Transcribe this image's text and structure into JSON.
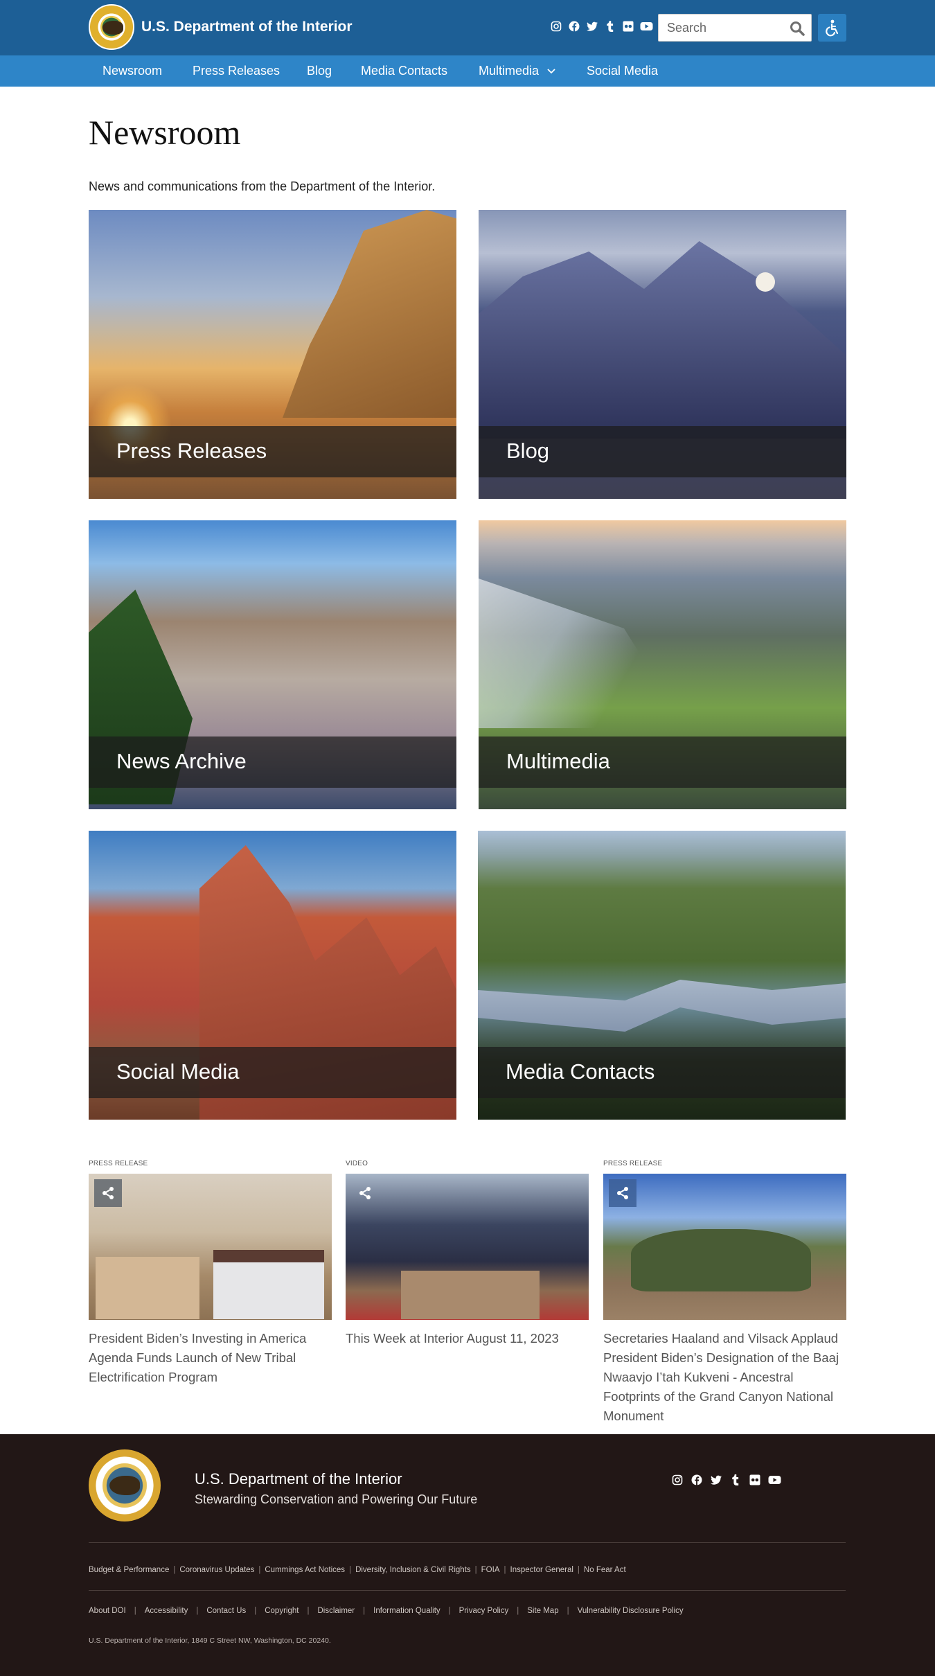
{
  "header": {
    "site_title": "U.S. Department of the Interior",
    "search_placeholder": "Search",
    "social_icons": [
      "instagram-icon",
      "facebook-icon",
      "twitter-icon",
      "tumblr-icon",
      "flickr-icon",
      "youtube-icon"
    ]
  },
  "nav": {
    "items": [
      {
        "label": "Newsroom"
      },
      {
        "label": "Press Releases"
      },
      {
        "label": "Blog"
      },
      {
        "label": "Media Contacts"
      },
      {
        "label": "Multimedia"
      },
      {
        "label": "Social Media"
      }
    ]
  },
  "main": {
    "title": "Newsroom",
    "intro": "News and communications from the Department of the Interior.",
    "tiles": [
      {
        "label": "Press Releases"
      },
      {
        "label": "Blog"
      },
      {
        "label": "News Archive"
      },
      {
        "label": "Multimedia"
      },
      {
        "label": "Social Media"
      },
      {
        "label": "Media Contacts"
      }
    ]
  },
  "featured": [
    {
      "kicker": "PRESS RELEASE",
      "title": "President Biden’s Investing in America Agenda Funds Launch of New Tribal Electrification Program"
    },
    {
      "kicker": "VIDEO",
      "title": "This Week at Interior August 11, 2023"
    },
    {
      "kicker": "PRESS RELEASE",
      "title": "Secretaries Haaland and Vilsack Applaud President Biden’s Designation of the Baaj Nwaavjo I’tah Kukveni - Ancestral Footprints of the Grand Canyon National Monument"
    }
  ],
  "footer": {
    "org_name": "U.S. Department of the Interior",
    "tagline": "Stewarding Conservation and Powering Our Future",
    "links_row1": [
      "Budget & Performance",
      "Coronavirus Updates",
      "Cummings Act Notices",
      "Diversity, Inclusion & Civil Rights",
      "FOIA",
      "Inspector General",
      "No Fear Act"
    ],
    "links_row2": [
      "About DOI",
      "Accessibility",
      "Contact Us",
      "Copyright",
      "Disclaimer",
      "Information Quality",
      "Privacy Policy",
      "Site Map",
      "Vulnerability Disclosure Policy"
    ],
    "address": "U.S. Department of the Interior, 1849 C Street NW, Washington, DC 20240."
  },
  "colors": {
    "header_bg": "#1d5f96",
    "nav_bg": "#2e85c8",
    "footer_bg": "#221716"
  }
}
